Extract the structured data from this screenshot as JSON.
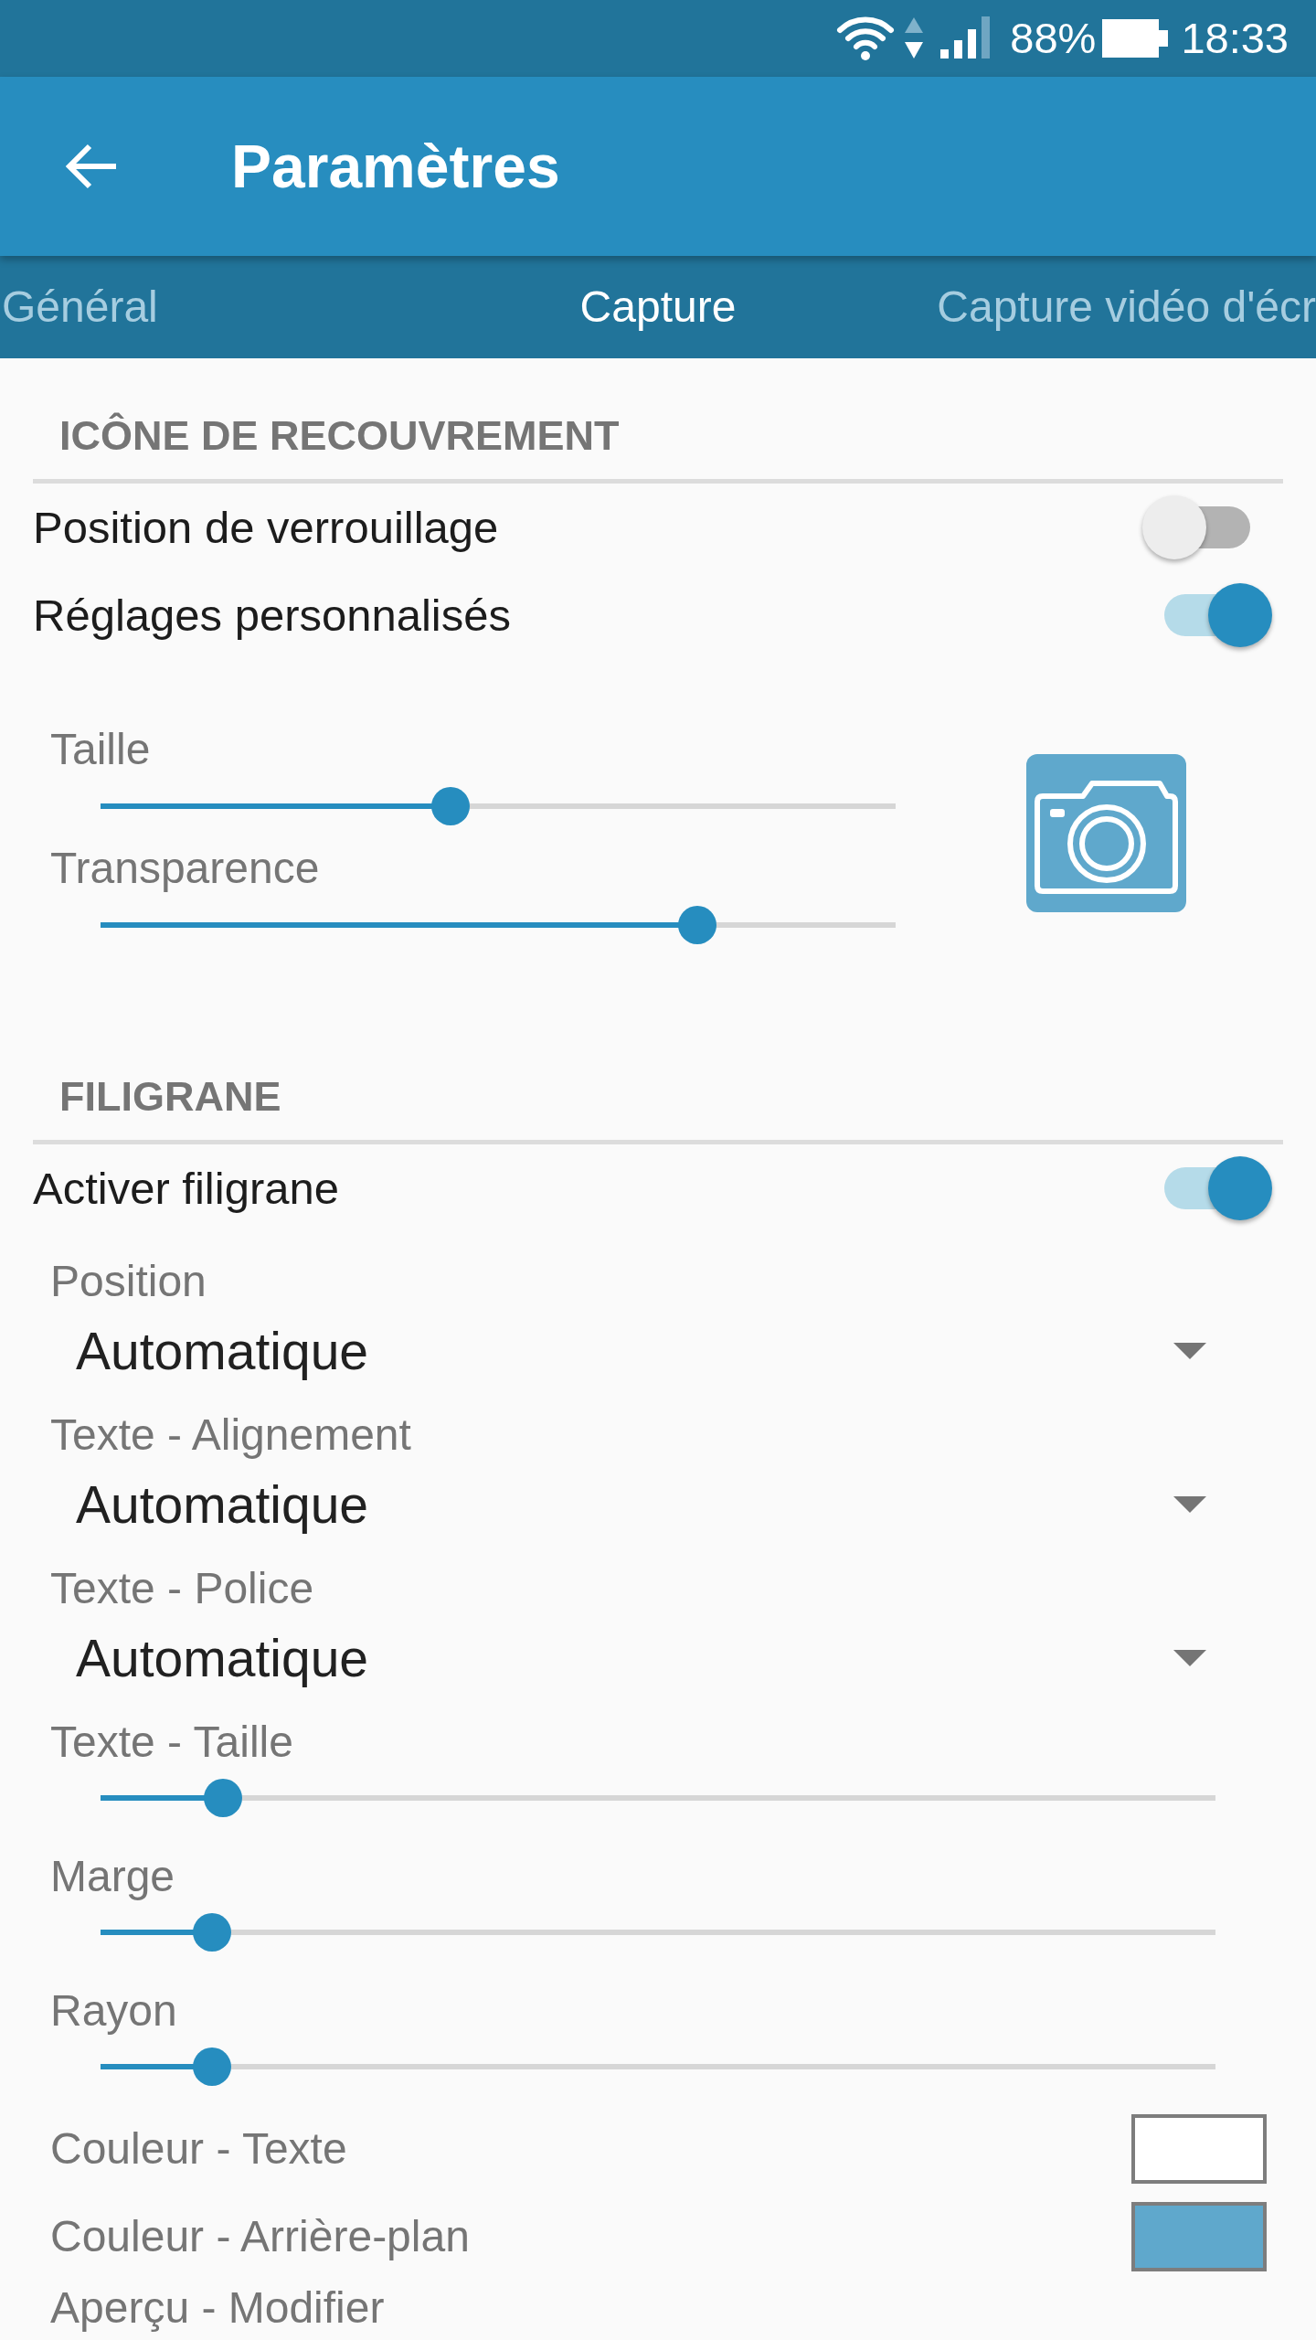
{
  "status_bar": {
    "battery": "88%",
    "time": "18:33"
  },
  "app_bar": {
    "title": "Paramètres"
  },
  "tabs": [
    {
      "label": "Général",
      "selected": false
    },
    {
      "label": "Capture",
      "selected": true
    },
    {
      "label": "Capture vidéo d'écr",
      "selected": false
    }
  ],
  "sections": [
    {
      "title": "ICÔNE DE RECOUVREMENT",
      "items": [
        {
          "kind": "switch",
          "label": "Position de verrouillage",
          "on": false
        },
        {
          "kind": "switch",
          "label": "Réglages personnalisés",
          "on": true
        },
        {
          "kind": "slider_group",
          "sliders": [
            {
              "label": "Taille",
              "level": 0.44
            },
            {
              "label": "Transparence",
              "level": 0.75
            }
          ]
        }
      ]
    },
    {
      "title": "FILIGRANE",
      "items": [
        {
          "kind": "switch",
          "label": "Activer filigrane",
          "on": true
        },
        {
          "kind": "dropdown",
          "label": "Position",
          "value": "Automatique"
        },
        {
          "kind": "dropdown",
          "label": "Texte - Alignement",
          "value": "Automatique"
        },
        {
          "kind": "dropdown",
          "label": "Texte - Police",
          "value": "Automatique"
        },
        {
          "kind": "slider",
          "label": "Texte - Taille",
          "level": 0.11
        },
        {
          "kind": "slider",
          "label": "Marge",
          "level": 0.1
        },
        {
          "kind": "slider",
          "label": "Rayon",
          "level": 0.1
        },
        {
          "kind": "color",
          "label": "Couleur - Texte",
          "color": "#ffffff"
        },
        {
          "kind": "color",
          "label": "Couleur - Arrière-plan",
          "color": "#5fa8cc"
        },
        {
          "kind": "action",
          "label": "Aperçu - Modifier"
        }
      ]
    }
  ]
}
